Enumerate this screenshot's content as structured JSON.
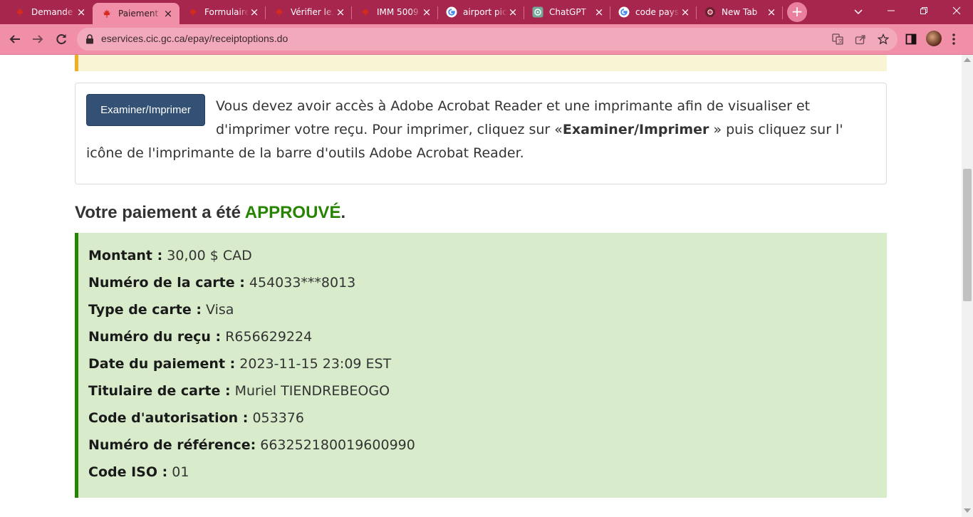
{
  "browser": {
    "tabs": [
      {
        "title": "Demande de…",
        "favicon": "maple-leaf-icon",
        "active": false
      },
      {
        "title": "Paiement",
        "favicon": "maple-leaf-icon",
        "active": true
      },
      {
        "title": "Formulaire",
        "favicon": "maple-leaf-icon",
        "active": false
      },
      {
        "title": "Vérifier le…",
        "favicon": "maple-leaf-icon",
        "active": false
      },
      {
        "title": "IMM 5009",
        "favicon": "maple-leaf-icon",
        "active": false
      },
      {
        "title": "airport pic…",
        "favicon": "google-icon",
        "active": false
      },
      {
        "title": "ChatGPT",
        "favicon": "chatgpt-icon",
        "active": false
      },
      {
        "title": "code pays…",
        "favicon": "google-icon",
        "active": false
      },
      {
        "title": "New Tab",
        "favicon": "chrome-icon",
        "active": false
      }
    ],
    "url": "eservices.cic.gc.ca/epay/receiptoptions.do",
    "colors": {
      "tabstrip": "#a7264d",
      "toolbar": "#f18fa8"
    }
  },
  "print_section": {
    "button_label": "Examiner/Imprimer",
    "text_before": "Vous devez avoir accès à Adobe Acrobat Reader et une imprimante afin de visualiser et d'imprimer votre reçu. Pour imprimer, cliquez sur «",
    "text_bold": "Examiner/Imprimer",
    "text_after": " » puis cliquez sur l' icône de l'imprimante de la barre d'outils Adobe Acrobat Reader."
  },
  "payment": {
    "heading_prefix": "Votre paiement a été ",
    "heading_status": "APPROUVÉ",
    "heading_suffix": ".",
    "status_color": "#278400",
    "details": [
      {
        "label": "Montant :",
        "value": "30,00 $ CAD"
      },
      {
        "label": "Numéro de la carte :",
        "value": "454033***8013"
      },
      {
        "label": "Type de carte :",
        "value": "Visa"
      },
      {
        "label": "Numéro du reçu :",
        "value": "R656629224"
      },
      {
        "label": "Date du paiement :",
        "value": "2023-11-15 23:09 EST"
      },
      {
        "label": "Titulaire de carte :",
        "value": "Muriel TIENDREBEOGO"
      },
      {
        "label": "Code d'autorisation :",
        "value": "053376"
      },
      {
        "label": "Numéro de référence:",
        "value": "663252180019600990"
      },
      {
        "label": "Code ISO :",
        "value": "01"
      }
    ]
  }
}
